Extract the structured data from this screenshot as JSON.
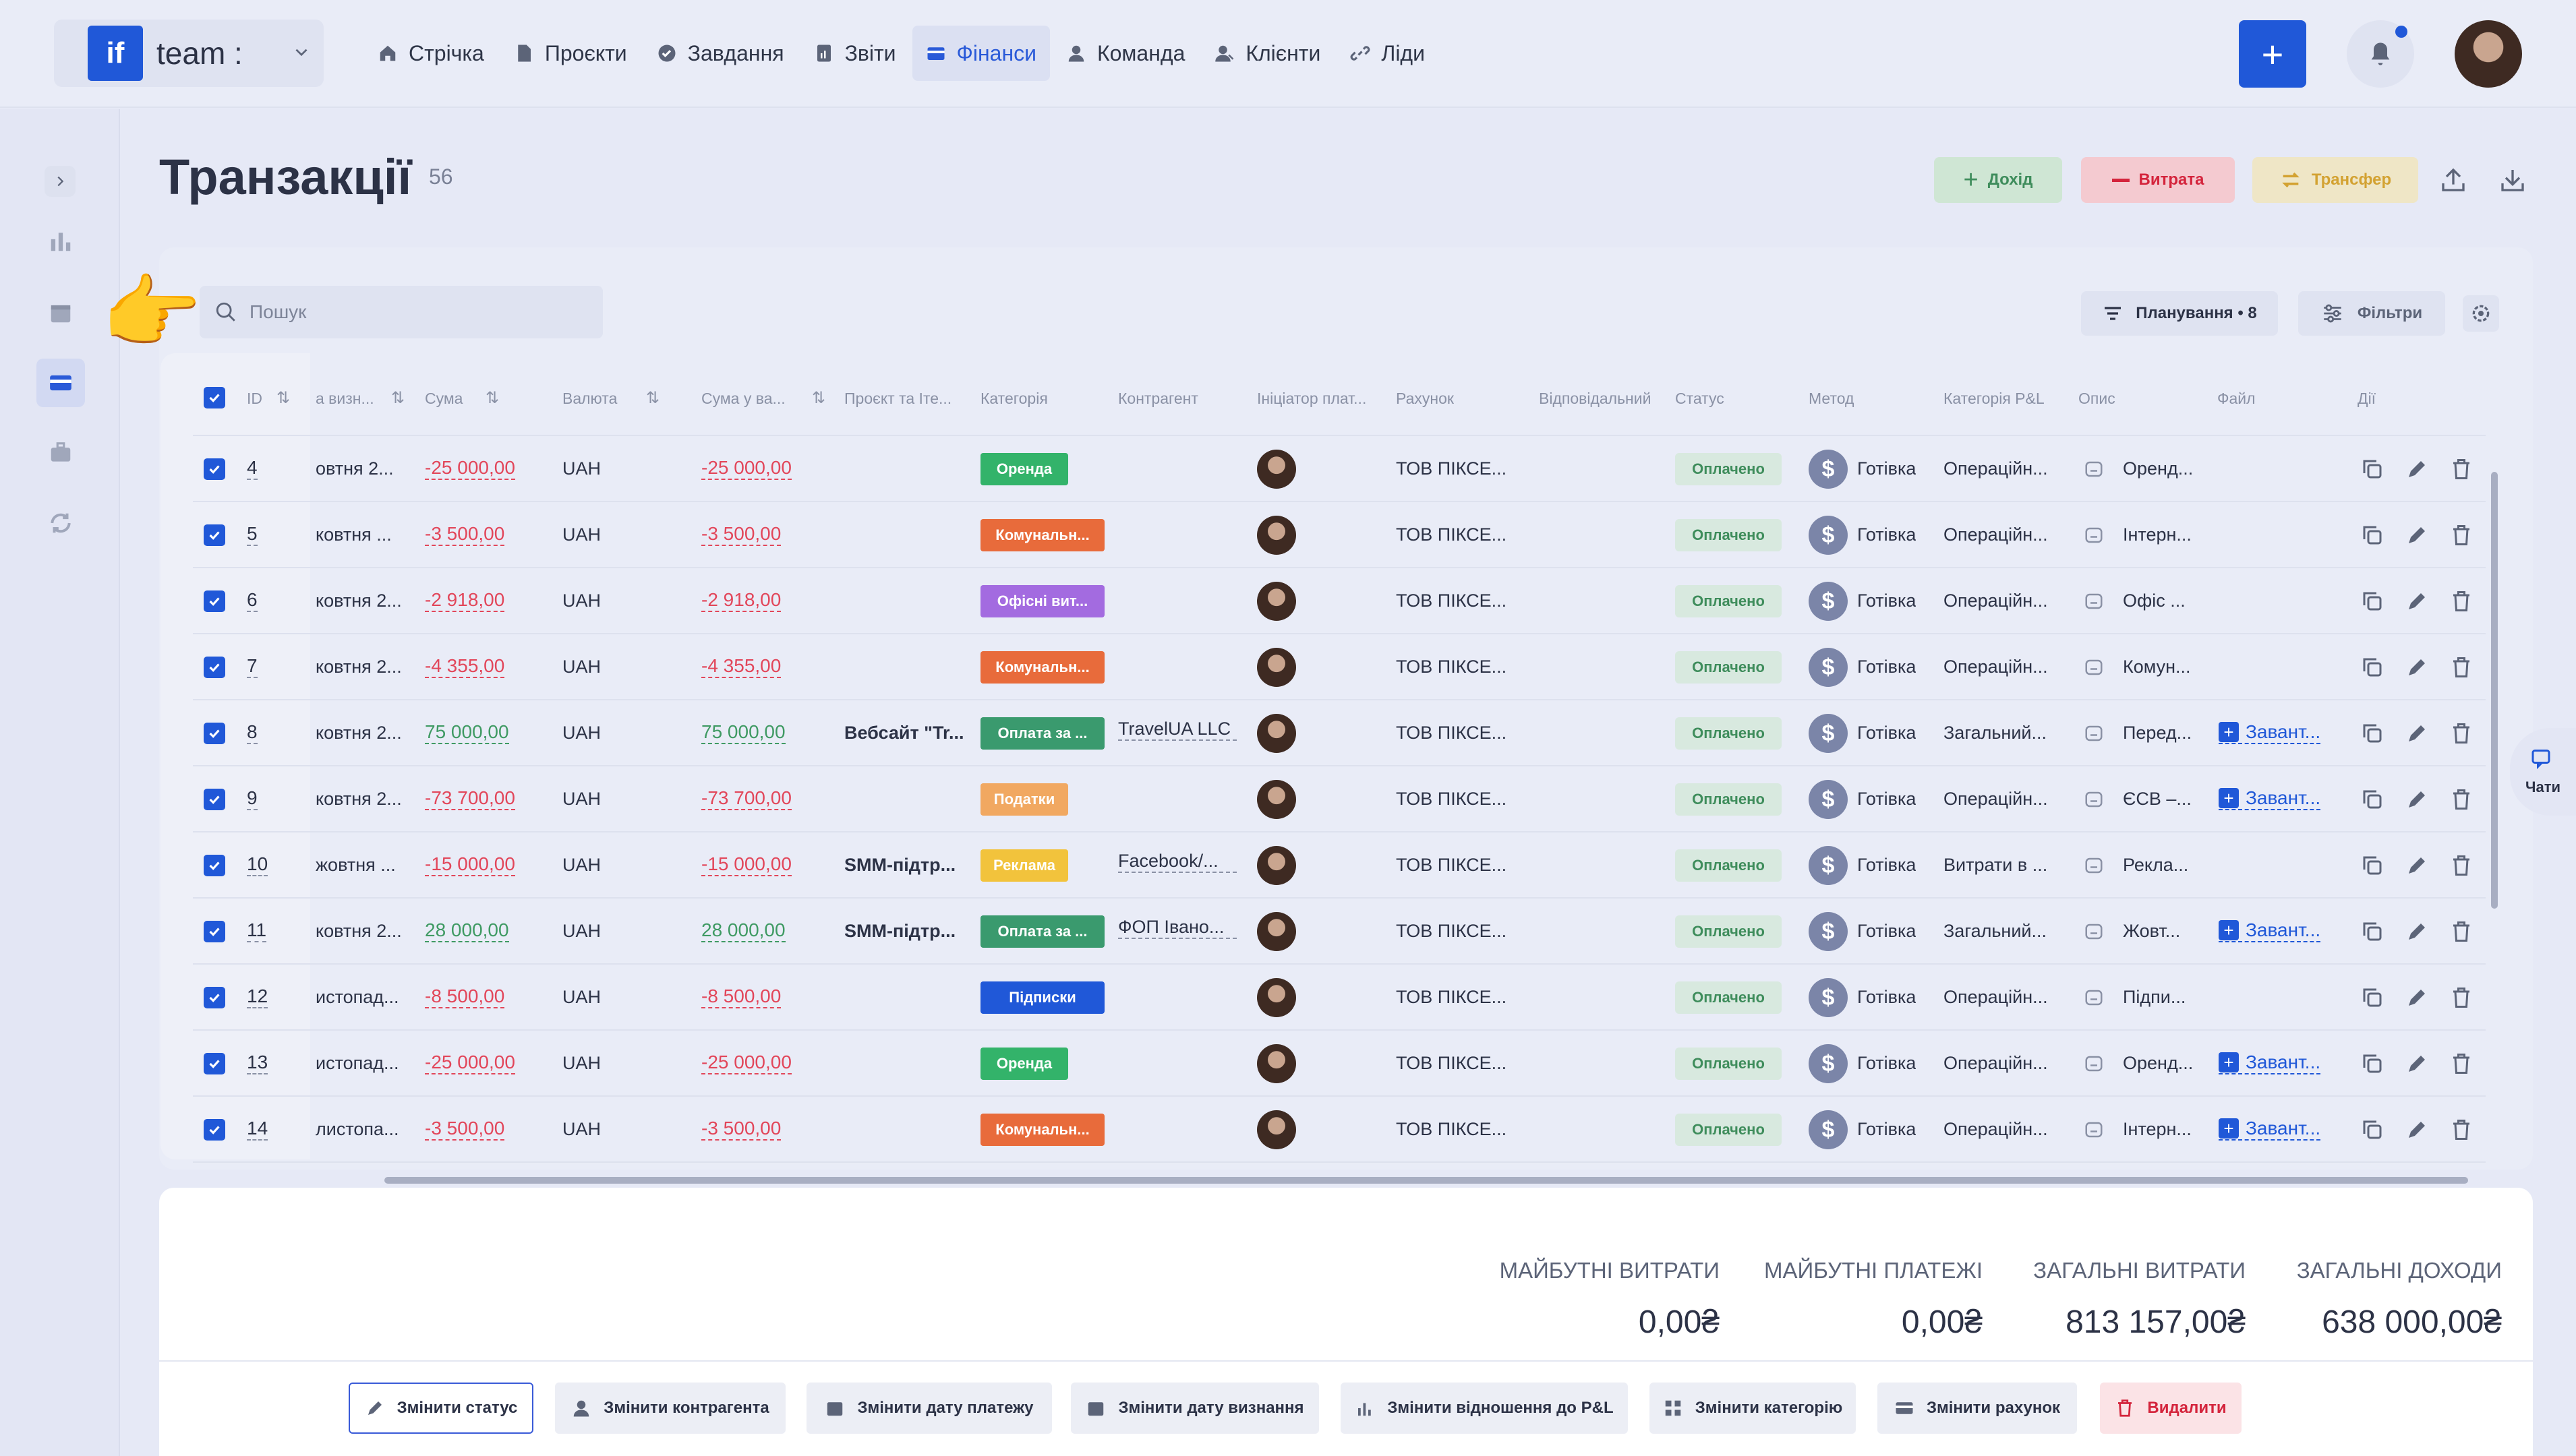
{
  "app": {
    "logo": "if",
    "team_name": "team :"
  },
  "nav": [
    {
      "label": "Стрічка",
      "icon": "home-icon"
    },
    {
      "label": "Проєкти",
      "icon": "document-icon"
    },
    {
      "label": "Завдання",
      "icon": "check-circle-icon"
    },
    {
      "label": "Звіти",
      "icon": "report-icon"
    },
    {
      "label": "Фінанси",
      "icon": "wallet-icon",
      "active": true
    },
    {
      "label": "Команда",
      "icon": "person-icon"
    },
    {
      "label": "Клієнти",
      "icon": "clients-icon"
    },
    {
      "label": "Ліди",
      "icon": "link-icon"
    }
  ],
  "page": {
    "title": "Транзакції",
    "count": "56"
  },
  "actions": {
    "income": "Дохід",
    "expense": "Витрата",
    "transfer": "Трансфер"
  },
  "toolbar": {
    "search_placeholder": "Пошук",
    "planning": "Планування • 8",
    "filters": "Фільтри"
  },
  "columns": [
    "ID",
    "а визн...",
    "Сума",
    "Валюта",
    "Сума у ва...",
    "Проєкт та Іте...",
    "Категорія",
    "Контрагент",
    "Ініціатор плат...",
    "Рахунок",
    "Відповідальний",
    "Статус",
    "Метод",
    "Категорія P&L",
    "Опис",
    "Файл",
    "Дії"
  ],
  "rows": [
    {
      "id": "4",
      "date": "овтня 2...",
      "amount": "-25 000,00",
      "currency": "UAH",
      "amount_acc": "-25 000,00",
      "project": "",
      "category": "Оренда",
      "cat_color": "#33b36a",
      "counterparty": "",
      "account": "ТОВ ПІКСЕ...",
      "status": "Оплачено",
      "method": "Готівка",
      "pl": "Операційн...",
      "desc": "Оренд...",
      "file": ""
    },
    {
      "id": "5",
      "date": "ковтня ...",
      "amount": "-3 500,00",
      "currency": "UAH",
      "amount_acc": "-3 500,00",
      "project": "",
      "category": "Комунальн...",
      "cat_color": "#e86b3b",
      "counterparty": "",
      "account": "ТОВ ПІКСЕ...",
      "status": "Оплачено",
      "method": "Готівка",
      "pl": "Операційн...",
      "desc": "Інтерн...",
      "file": ""
    },
    {
      "id": "6",
      "date": "ковтня 2...",
      "amount": "-2 918,00",
      "currency": "UAH",
      "amount_acc": "-2 918,00",
      "project": "",
      "category": "Офісні вит...",
      "cat_color": "#a36be0",
      "counterparty": "",
      "account": "ТОВ ПІКСЕ...",
      "status": "Оплачено",
      "method": "Готівка",
      "pl": "Операційн...",
      "desc": "Офіс ...",
      "file": ""
    },
    {
      "id": "7",
      "date": "ковтня 2...",
      "amount": "-4 355,00",
      "currency": "UAH",
      "amount_acc": "-4 355,00",
      "project": "",
      "category": "Комунальн...",
      "cat_color": "#e86b3b",
      "counterparty": "",
      "account": "ТОВ ПІКСЕ...",
      "status": "Оплачено",
      "method": "Готівка",
      "pl": "Операційн...",
      "desc": "Комун...",
      "file": ""
    },
    {
      "id": "8",
      "date": "ковтня 2...",
      "amount": "75 000,00",
      "currency": "UAH",
      "amount_acc": "75 000,00",
      "project": "Вебсайт \"Tr...",
      "category": "Оплата за ...",
      "cat_color": "#3a9a6e",
      "counterparty": "TravelUA LLC",
      "account": "ТОВ ПІКСЕ...",
      "status": "Оплачено",
      "method": "Готівка",
      "pl": "Загальний...",
      "desc": "Перед...",
      "file": "Завант..."
    },
    {
      "id": "9",
      "date": "ковтня 2...",
      "amount": "-73 700,00",
      "currency": "UAH",
      "amount_acc": "-73 700,00",
      "project": "",
      "category": "Податки",
      "cat_color": "#f1a861",
      "counterparty": "",
      "account": "ТОВ ПІКСЕ...",
      "status": "Оплачено",
      "method": "Готівка",
      "pl": "Операційн...",
      "desc": "ЄСВ –...",
      "file": "Завант..."
    },
    {
      "id": "10",
      "date": "жовтня ...",
      "amount": "-15 000,00",
      "currency": "UAH",
      "amount_acc": "-15 000,00",
      "project": "SMM-підтр...",
      "category": "Реклама",
      "cat_color": "#f2c33c",
      "counterparty": "Facebook/...",
      "account": "ТОВ ПІКСЕ...",
      "status": "Оплачено",
      "method": "Готівка",
      "pl": "Витрати в ...",
      "desc": "Рекла...",
      "file": ""
    },
    {
      "id": "11",
      "date": "ковтня 2...",
      "amount": "28 000,00",
      "currency": "UAH",
      "amount_acc": "28 000,00",
      "project": "SMM-підтр...",
      "category": "Оплата за ...",
      "cat_color": "#3a9a6e",
      "counterparty": "ФОП Івано...",
      "account": "ТОВ ПІКСЕ...",
      "status": "Оплачено",
      "method": "Готівка",
      "pl": "Загальний...",
      "desc": "Жовт...",
      "file": "Завант..."
    },
    {
      "id": "12",
      "date": "истопад...",
      "amount": "-8 500,00",
      "currency": "UAH",
      "amount_acc": "-8 500,00",
      "project": "",
      "category": "Підписки",
      "cat_color": "#2058d8",
      "counterparty": "",
      "account": "ТОВ ПІКСЕ...",
      "status": "Оплачено",
      "method": "Готівка",
      "pl": "Операційн...",
      "desc": "Підпи...",
      "file": ""
    },
    {
      "id": "13",
      "date": "истопад...",
      "amount": "-25 000,00",
      "currency": "UAH",
      "amount_acc": "-25 000,00",
      "project": "",
      "category": "Оренда",
      "cat_color": "#33b36a",
      "counterparty": "",
      "account": "ТОВ ПІКСЕ...",
      "status": "Оплачено",
      "method": "Готівка",
      "pl": "Операційн...",
      "desc": "Оренд...",
      "file": "Завант..."
    },
    {
      "id": "14",
      "date": "листопа...",
      "amount": "-3 500,00",
      "currency": "UAH",
      "amount_acc": "-3 500,00",
      "project": "",
      "category": "Комунальн...",
      "cat_color": "#e86b3b",
      "counterparty": "",
      "account": "ТОВ ПІКСЕ...",
      "status": "Оплачено",
      "method": "Готівка",
      "pl": "Операційн...",
      "desc": "Інтерн...",
      "file": "Завант..."
    }
  ],
  "totals": [
    {
      "label": "МАЙБУТНІ ВИТРАТИ",
      "value": "0,00₴"
    },
    {
      "label": "МАЙБУТНІ ПЛАТЕЖІ",
      "value": "0,00₴"
    },
    {
      "label": "ЗАГАЛЬНІ ВИТРАТИ",
      "value": "813 157,00₴"
    },
    {
      "label": "ЗАГАЛЬНІ ДОХОДИ",
      "value": "638 000,00₴"
    }
  ],
  "bulk_actions": [
    {
      "label": "Змінити статус",
      "icon": "pencil-icon"
    },
    {
      "label": "Змінити контрагента",
      "icon": "person-icon"
    },
    {
      "label": "Змінити дату платежу",
      "icon": "calendar-icon"
    },
    {
      "label": "Змінити дату визнання",
      "icon": "calendar-icon"
    },
    {
      "label": "Змінити відношення до P&L",
      "icon": "bar-chart-icon"
    },
    {
      "label": "Змінити категорію",
      "icon": "grid-icon"
    },
    {
      "label": "Змінити рахунок",
      "icon": "card-icon"
    },
    {
      "label": "Видалити",
      "icon": "trash-icon"
    }
  ],
  "chat": {
    "label": "Чати"
  },
  "colors": {
    "accent": "#2058d8",
    "negative": "#e2465a",
    "positive": "#3f9a63"
  }
}
